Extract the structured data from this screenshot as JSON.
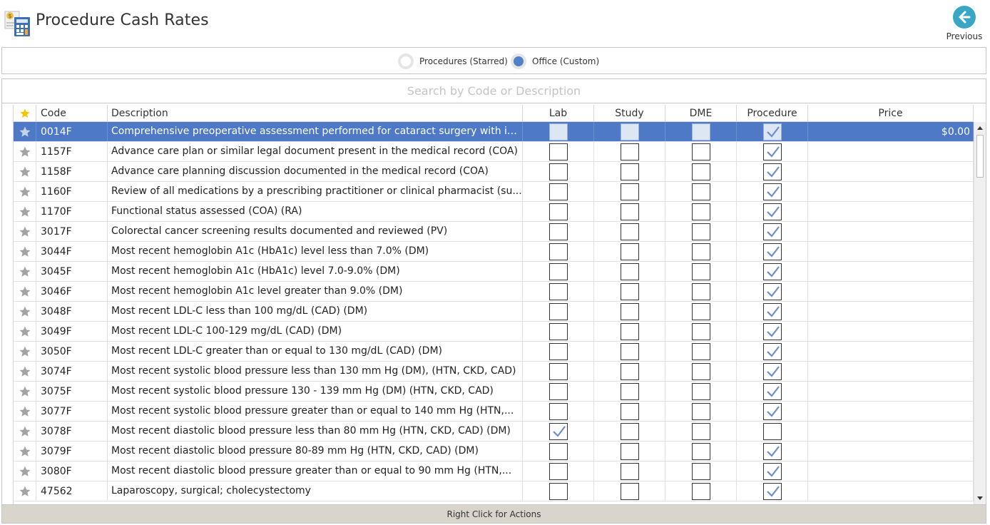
{
  "header": {
    "title": "Procedure Cash Rates",
    "previous_label": "Previous"
  },
  "radio": {
    "options": [
      {
        "label": "Procedures (Starred)",
        "selected": false
      },
      {
        "label": "Office (Custom)",
        "selected": true
      }
    ]
  },
  "search": {
    "placeholder": "Search by Code or Description"
  },
  "columns": {
    "code": "Code",
    "description": "Description",
    "lab": "Lab",
    "study": "Study",
    "dme": "DME",
    "procedure": "Procedure",
    "price": "Price"
  },
  "colors": {
    "selected_row": "#4e79c6",
    "star_active": "#f5c400",
    "star_inactive": "#a3a3a3",
    "check": "#6b8fc6",
    "previous_button": "#3aa6c6"
  },
  "rows": [
    {
      "code": "0014F",
      "description": "Comprehensive preoperative assessment performed for cataract surgery with in...",
      "lab": false,
      "study": false,
      "dme": false,
      "procedure": true,
      "price": "$0.00",
      "selected": true
    },
    {
      "code": "1157F",
      "description": "Advance care plan or similar legal document present in the medical record (COA)",
      "lab": false,
      "study": false,
      "dme": false,
      "procedure": true,
      "price": ""
    },
    {
      "code": "1158F",
      "description": "Advance care planning discussion documented in the medical record (COA)",
      "lab": false,
      "study": false,
      "dme": false,
      "procedure": true,
      "price": ""
    },
    {
      "code": "1160F",
      "description": "Review of all medications by a prescribing practitioner or clinical pharmacist (su...",
      "lab": false,
      "study": false,
      "dme": false,
      "procedure": true,
      "price": ""
    },
    {
      "code": "1170F",
      "description": "Functional status assessed (COA) (RA)",
      "lab": false,
      "study": false,
      "dme": false,
      "procedure": true,
      "price": ""
    },
    {
      "code": "3017F",
      "description": "Colorectal cancer screening results documented and reviewed (PV)",
      "lab": false,
      "study": false,
      "dme": false,
      "procedure": true,
      "price": ""
    },
    {
      "code": "3044F",
      "description": "Most recent hemoglobin A1c (HbA1c) level less than 7.0% (DM)",
      "lab": false,
      "study": false,
      "dme": false,
      "procedure": true,
      "price": ""
    },
    {
      "code": "3045F",
      "description": "Most recent hemoglobin A1c (HbA1c) level 7.0-9.0% (DM)",
      "lab": false,
      "study": false,
      "dme": false,
      "procedure": true,
      "price": ""
    },
    {
      "code": "3046F",
      "description": "Most recent hemoglobin A1c level greater than 9.0% (DM)",
      "lab": false,
      "study": false,
      "dme": false,
      "procedure": true,
      "price": ""
    },
    {
      "code": "3048F",
      "description": "Most recent LDL-C less than 100 mg/dL (CAD) (DM)",
      "lab": false,
      "study": false,
      "dme": false,
      "procedure": true,
      "price": ""
    },
    {
      "code": "3049F",
      "description": "Most recent LDL-C 100-129 mg/dL (CAD) (DM)",
      "lab": false,
      "study": false,
      "dme": false,
      "procedure": true,
      "price": ""
    },
    {
      "code": "3050F",
      "description": "Most recent LDL-C greater than or equal to 130 mg/dL (CAD) (DM)",
      "lab": false,
      "study": false,
      "dme": false,
      "procedure": true,
      "price": ""
    },
    {
      "code": "3074F",
      "description": "Most recent systolic blood pressure less than 130 mm Hg (DM), (HTN, CKD, CAD)",
      "lab": false,
      "study": false,
      "dme": false,
      "procedure": true,
      "price": ""
    },
    {
      "code": "3075F",
      "description": "Most recent systolic blood pressure 130 - 139 mm Hg (DM) (HTN, CKD, CAD)",
      "lab": false,
      "study": false,
      "dme": false,
      "procedure": true,
      "price": ""
    },
    {
      "code": "3077F",
      "description": "Most recent systolic blood pressure greater than or equal to 140 mm Hg (HTN,...",
      "lab": false,
      "study": false,
      "dme": false,
      "procedure": true,
      "price": ""
    },
    {
      "code": "3078F",
      "description": "Most recent diastolic blood pressure less than 80 mm Hg (HTN, CKD, CAD) (DM)",
      "lab": true,
      "study": false,
      "dme": false,
      "procedure": false,
      "price": ""
    },
    {
      "code": "3079F",
      "description": "Most recent diastolic blood pressure 80-89 mm Hg (HTN, CKD, CAD) (DM)",
      "lab": false,
      "study": false,
      "dme": false,
      "procedure": true,
      "price": ""
    },
    {
      "code": "3080F",
      "description": "Most recent diastolic blood pressure greater than or equal to 90 mm Hg (HTN,...",
      "lab": false,
      "study": false,
      "dme": false,
      "procedure": true,
      "price": ""
    },
    {
      "code": "47562",
      "description": "Laparoscopy, surgical; cholecystectomy",
      "lab": false,
      "study": false,
      "dme": false,
      "procedure": true,
      "price": ""
    }
  ],
  "footer": {
    "text": "Right Click for Actions"
  }
}
